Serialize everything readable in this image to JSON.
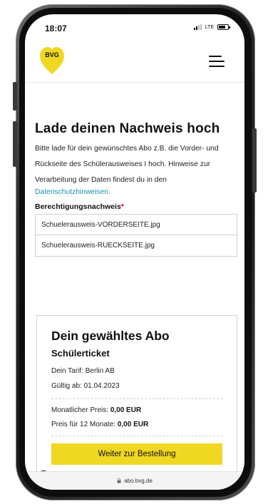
{
  "status_bar": {
    "time": "18:07",
    "network": "LTE"
  },
  "header": {
    "logo_text": "BVG",
    "logo_color": "#f0d722"
  },
  "upload": {
    "title": "Lade deinen Nachweis hoch",
    "intro_line1": "Bitte lade für dein gewünschtes Abo z.B. die Vorder- und",
    "intro_line2": "Rückseite des Schülerausweises I hoch. Hinweise zur",
    "intro_line3": "Verarbeitung der Daten findest du in den",
    "privacy_link": "Datenschutzhinweisen.",
    "field_label": "Berechtigungsnachweis",
    "required_mark": "*",
    "files": [
      "Schuelerausweis-VORDERSEITE.jpg",
      "Schuelerausweis-RUECKSEITE.jpg"
    ]
  },
  "abo": {
    "title": "Dein gewähltes Abo",
    "product": "Schülerticket",
    "tarif": "Dein Tarif: Berlin AB",
    "gueltig": "Gültig ab: 01.04.2023",
    "monthly_label": "Monatlicher Preis:",
    "monthly_value": "0,00 EUR",
    "yearly_label": "Preis für 12 Monate:",
    "yearly_value": "0,00 EUR",
    "button_label": "Weiter zur Bestellung",
    "button_color": "#f0d722"
  },
  "browser": {
    "url": "abo.bvg.de"
  },
  "icons": [
    "signal-icon",
    "battery-icon",
    "menu-icon",
    "cookie-icon",
    "lock-icon"
  ]
}
